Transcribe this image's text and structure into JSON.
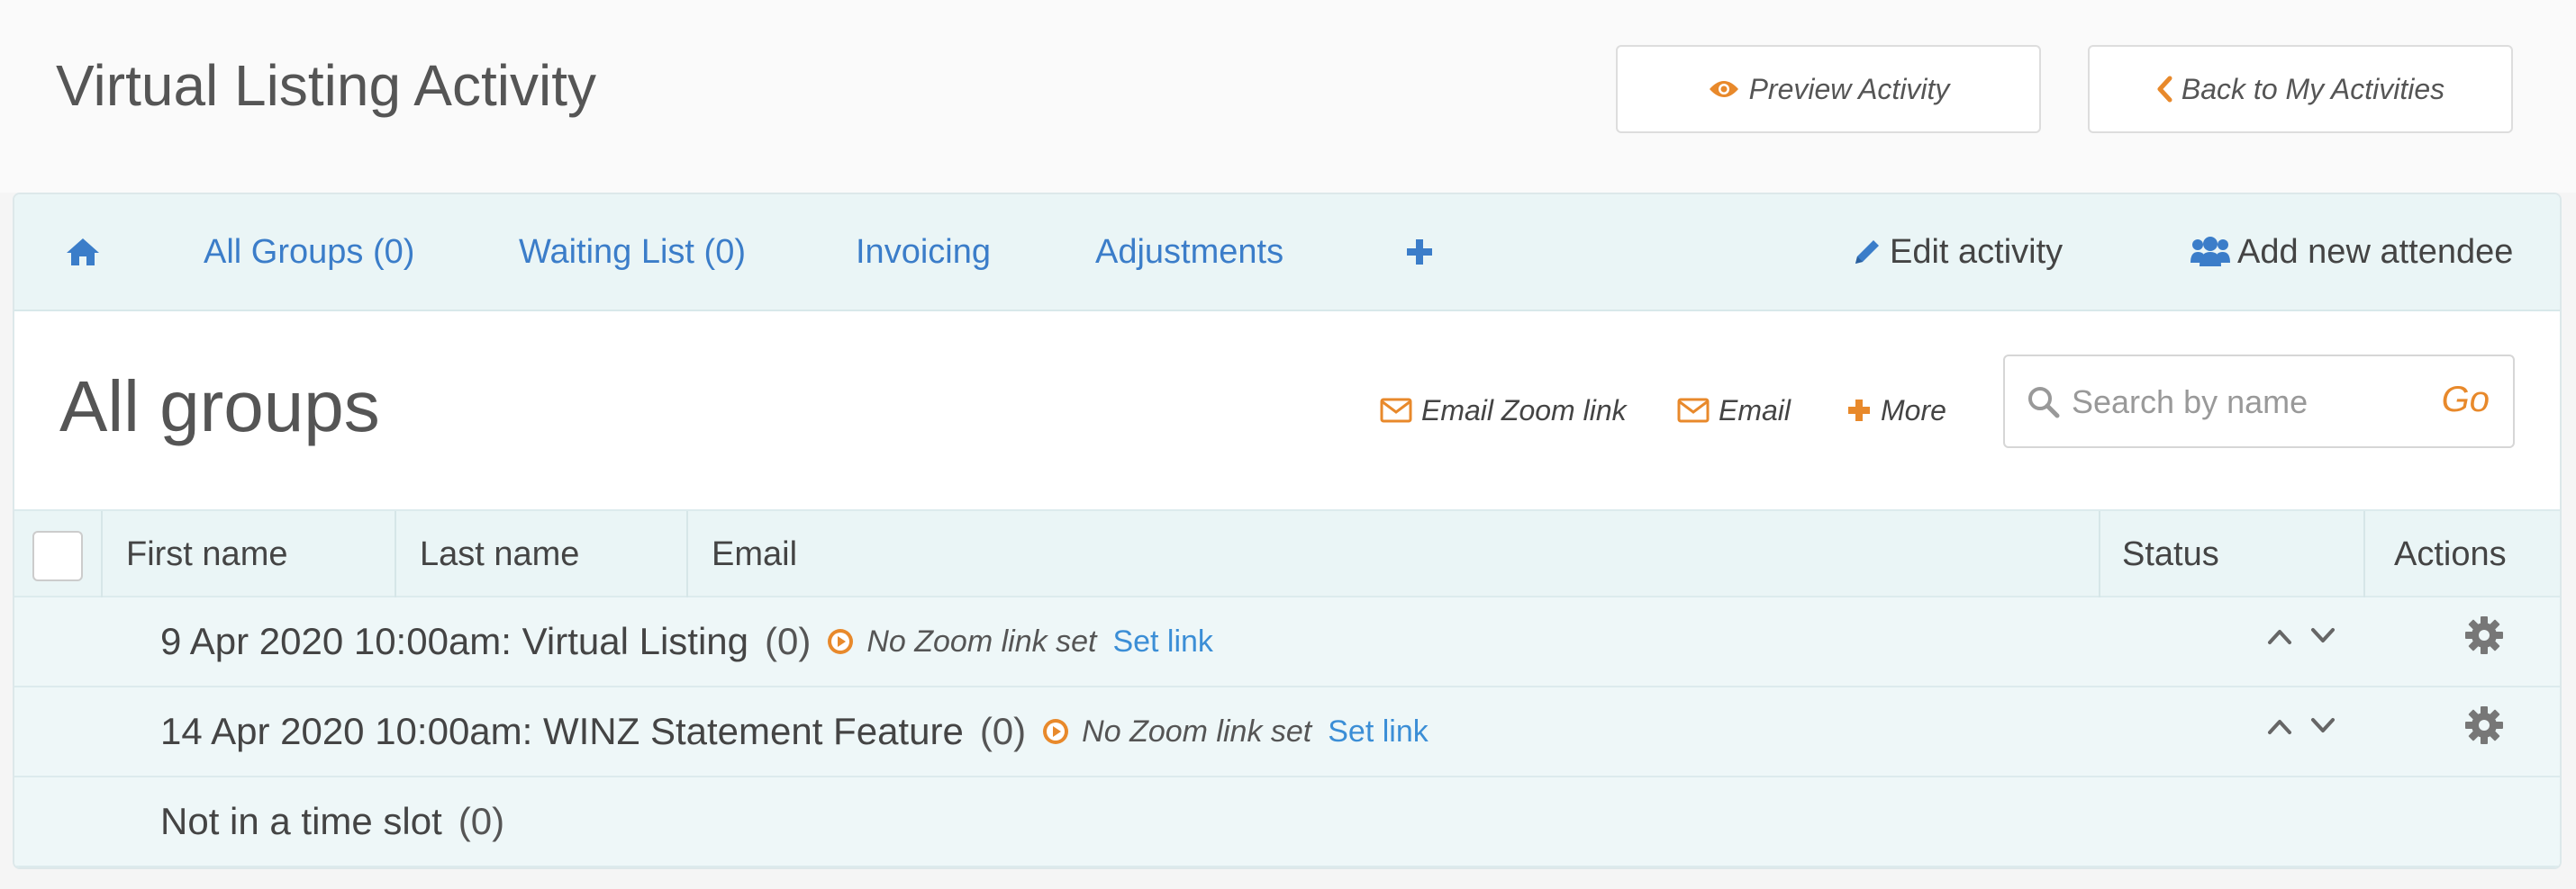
{
  "header": {
    "title": "Virtual Listing Activity",
    "preview_label": "Preview Activity",
    "back_label": "Back to My Activities"
  },
  "nav": {
    "items": [
      {
        "label": "All Groups (0)"
      },
      {
        "label": "Waiting List (0)"
      },
      {
        "label": "Invoicing"
      },
      {
        "label": "Adjustments"
      }
    ],
    "edit_label": "Edit activity",
    "add_attendee_label": "Add new attendee"
  },
  "section": {
    "title": "All groups",
    "email_zoom_label": "Email Zoom link",
    "email_label": "Email",
    "more_label": "More"
  },
  "search": {
    "placeholder": "Search by name",
    "go_label": "Go"
  },
  "table": {
    "columns": [
      "First name",
      "Last name",
      "Email",
      "Status",
      "Actions"
    ],
    "groups": [
      {
        "name": "9 Apr 2020 10:00am: Virtual Listing",
        "count": "(0)",
        "zoom_status": "No Zoom link set",
        "link_label": "Set link"
      },
      {
        "name": "14 Apr 2020 10:00am: WINZ Statement Feature",
        "count": "(0)",
        "zoom_status": "No Zoom link set",
        "link_label": "Set link"
      },
      {
        "name": "Not in a time slot",
        "count": "(0)"
      }
    ]
  },
  "icons": [
    "eye-icon",
    "chevron-left-icon",
    "home-icon",
    "plus-icon",
    "pencil-icon",
    "users-icon",
    "envelope-icon",
    "search-icon",
    "play-circle-icon",
    "chevron-up-icon",
    "chevron-down-icon",
    "gear-icon"
  ],
  "colors": {
    "accent_orange": "#e8892b",
    "link_blue": "#3b7dc9",
    "nav_background": "#eaf5f6"
  }
}
